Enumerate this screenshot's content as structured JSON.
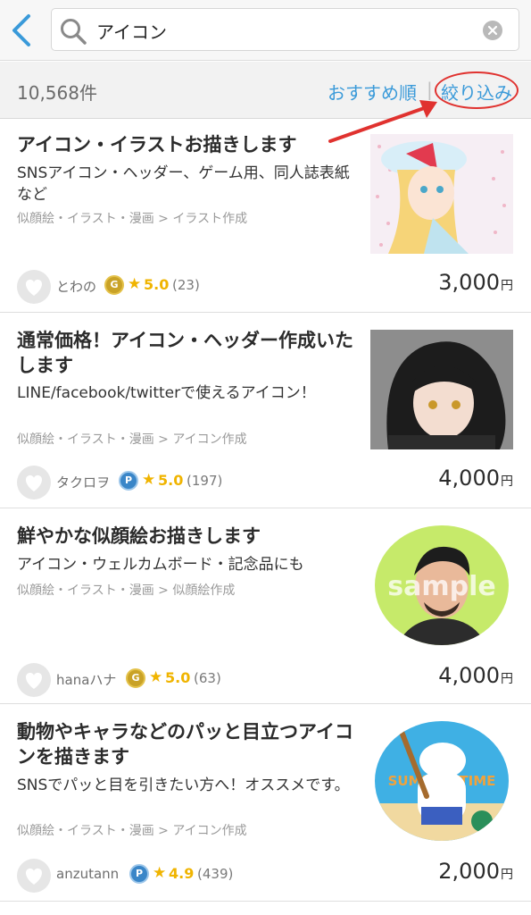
{
  "search": {
    "query": "アイコン"
  },
  "results": {
    "count": "10,568件",
    "sort_label": "おすすめ順",
    "separator": "|",
    "filter_label": "絞り込み"
  },
  "icons": {
    "back": "chevron-left-icon",
    "search": "search-icon",
    "clear": "clear-icon",
    "favorite": "heart-icon",
    "star": "star-icon"
  },
  "colors": {
    "accent": "#3a9ad9",
    "star": "#f0b400",
    "annotation": "#e0322f",
    "gold_rank": "#c9a227",
    "platinum_rank": "#3a86c8"
  },
  "listings": [
    {
      "title": "アイコン・イラストお描きします",
      "description": "SNSアイコン・ヘッダー、ゲーム用、同人誌表紙など",
      "category": "似顔絵・イラスト・漫画 > イラスト作成",
      "seller": "とわの",
      "rank_badge": "G",
      "star": "★",
      "rating": "5.0",
      "reviews": "(23)",
      "price": "3,000",
      "currency": "円"
    },
    {
      "title": "通常価格！アイコン・ヘッダー作成いたします",
      "description": "LINE/facebook/twitterで使えるアイコン！",
      "category": "似顔絵・イラスト・漫画 > アイコン作成",
      "seller": "タクロヲ",
      "rank_badge": "P",
      "star": "★",
      "rating": "5.0",
      "reviews": "(197)",
      "price": "4,000",
      "currency": "円"
    },
    {
      "title": "鮮やかな似顔絵お描きします",
      "description": "アイコン・ウェルカムボード・記念品にも",
      "category": "似顔絵・イラスト・漫画 > 似顔絵作成",
      "seller": "hanaハナ",
      "rank_badge": "G",
      "star": "★",
      "rating": "5.0",
      "reviews": "(63)",
      "price": "4,000",
      "currency": "円",
      "image_text": "sample"
    },
    {
      "title": "動物やキャラなどのパッと目立つアイコンを描きます",
      "description": "SNSでパッと目を引きたい方へ！オススメです。",
      "category": "似顔絵・イラスト・漫画 > アイコン作成",
      "seller": "anzutann",
      "rank_badge": "P",
      "star": "★",
      "rating": "4.9",
      "reviews": "(439)",
      "price": "2,000",
      "currency": "円",
      "image_text": "SUMMER TIME"
    }
  ]
}
